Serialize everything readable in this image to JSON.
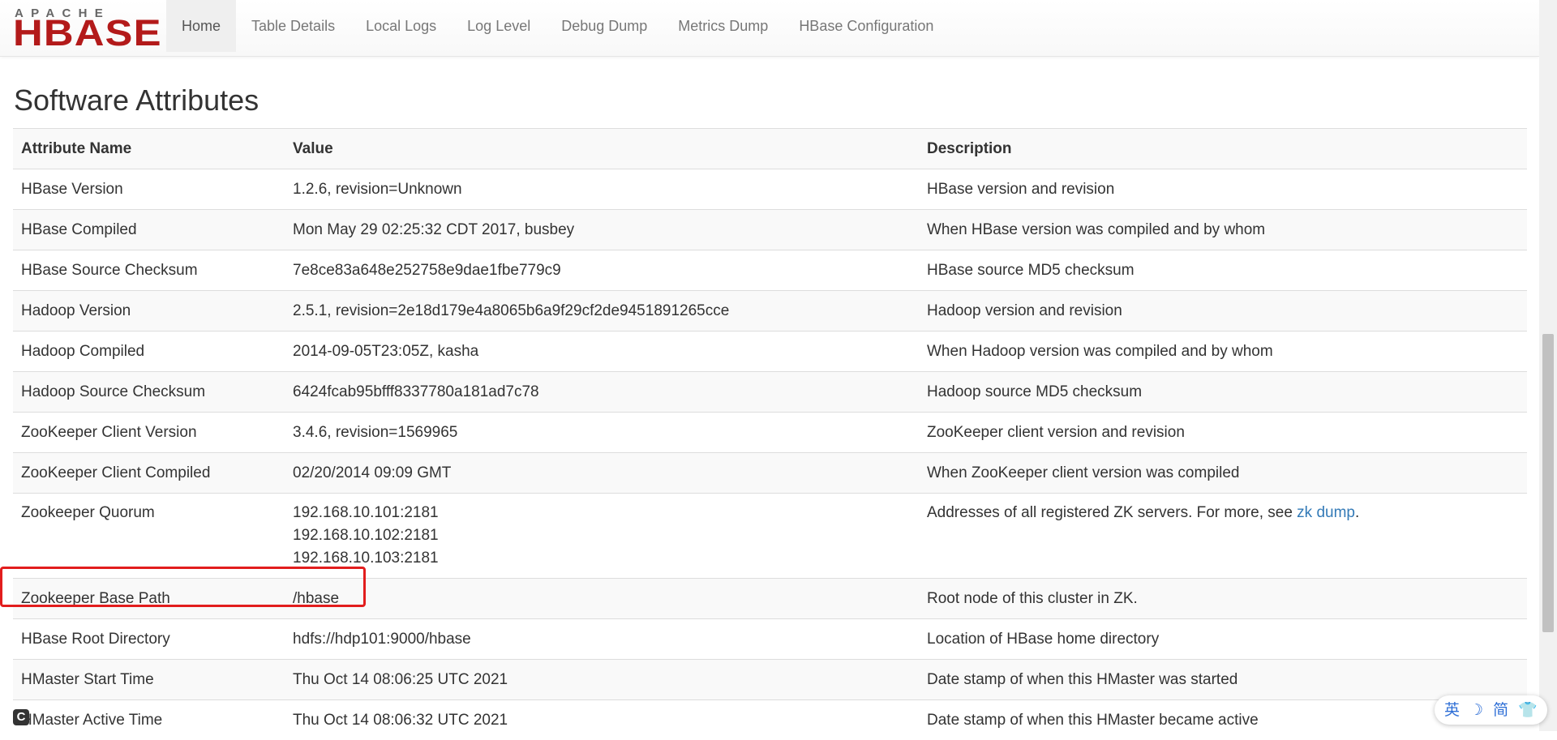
{
  "header": {
    "logo_top": "APACHE",
    "logo_main": "HBASE",
    "nav": [
      "Home",
      "Table Details",
      "Local Logs",
      "Log Level",
      "Debug Dump",
      "Metrics Dump",
      "HBase Configuration"
    ]
  },
  "page_title": "Software Attributes",
  "table": {
    "headers": [
      "Attribute Name",
      "Value",
      "Description"
    ],
    "rows": [
      {
        "name": "HBase Version",
        "value": "1.2.6, revision=Unknown",
        "desc": "HBase version and revision"
      },
      {
        "name": "HBase Compiled",
        "value": "Mon May 29 02:25:32 CDT 2017, busbey",
        "desc": "When HBase version was compiled and by whom"
      },
      {
        "name": "HBase Source Checksum",
        "value": "7e8ce83a648e252758e9dae1fbe779c9",
        "desc": "HBase source MD5 checksum"
      },
      {
        "name": "Hadoop Version",
        "value": "2.5.1, revision=2e18d179e4a8065b6a9f29cf2de9451891265cce",
        "desc": "Hadoop version and revision"
      },
      {
        "name": "Hadoop Compiled",
        "value": "2014-09-05T23:05Z, kasha",
        "desc": "When Hadoop version was compiled and by whom"
      },
      {
        "name": "Hadoop Source Checksum",
        "value": "6424fcab95bfff8337780a181ad7c78",
        "desc": "Hadoop source MD5 checksum"
      },
      {
        "name": "ZooKeeper Client Version",
        "value": "3.4.6, revision=1569965",
        "desc": "ZooKeeper client version and revision"
      },
      {
        "name": "ZooKeeper Client Compiled",
        "value": "02/20/2014 09:09 GMT",
        "desc": "When ZooKeeper client version was compiled"
      },
      {
        "name": "Zookeeper Quorum",
        "value_lines": [
          "192.168.10.101:2181",
          "192.168.10.102:2181",
          "192.168.10.103:2181"
        ],
        "desc": "Addresses of all registered ZK servers. For more, see ",
        "desc_link": "zk dump",
        "desc_suffix": "."
      },
      {
        "name": "Zookeeper Base Path",
        "value": "/hbase",
        "desc": "Root node of this cluster in ZK."
      },
      {
        "name": "HBase Root Directory",
        "value": "hdfs://hdp101:9000/hbase",
        "desc": "Location of HBase home directory"
      },
      {
        "name": "HMaster Start Time",
        "value": "Thu Oct 14 08:06:25 UTC 2021",
        "desc": "Date stamp of when this HMaster was started"
      },
      {
        "name": "HMaster Active Time",
        "value": "Thu Oct 14 08:06:32 UTC 2021",
        "desc": "Date stamp of when this HMaster became active"
      }
    ]
  },
  "overlay": {
    "corner_icon_label": "C",
    "ime_items": [
      "英",
      "☽",
      "简",
      "👕"
    ]
  },
  "colors": {
    "logo_red": "#b31a1a",
    "link": "#337ab7",
    "highlight": "#e21d1d"
  }
}
